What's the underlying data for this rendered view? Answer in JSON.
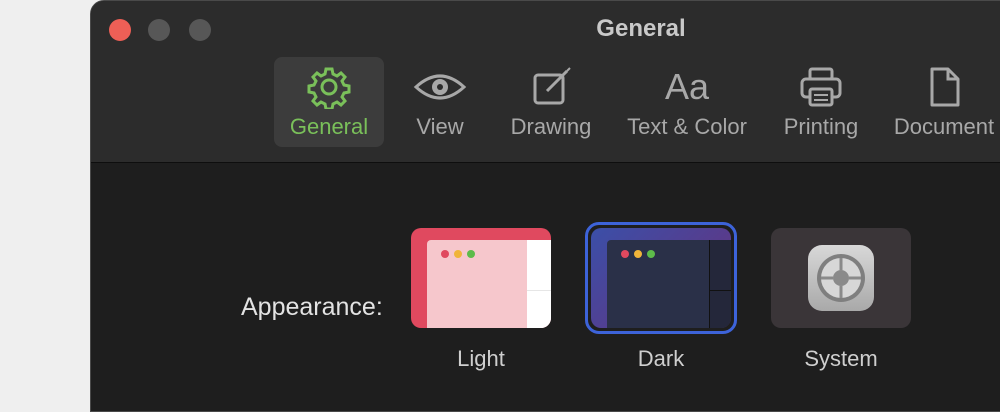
{
  "window": {
    "title": "General"
  },
  "toolbar": {
    "items": [
      {
        "label": "General",
        "icon": "gear-icon",
        "selected": true
      },
      {
        "label": "View",
        "icon": "eye-icon"
      },
      {
        "label": "Drawing",
        "icon": "pencil-square-icon"
      },
      {
        "label": "Text & Color",
        "icon_text": "Aa"
      },
      {
        "label": "Printing",
        "icon": "printer-icon"
      },
      {
        "label": "Document",
        "icon": "document-icon"
      }
    ]
  },
  "appearance": {
    "label": "Appearance:",
    "options": [
      {
        "label": "Light"
      },
      {
        "label": "Dark",
        "selected": true
      },
      {
        "label": "System"
      }
    ]
  },
  "colors": {
    "close": "#ee5f56",
    "accent_green": "#7ac05a",
    "selection_blue": "#3d63d9"
  }
}
